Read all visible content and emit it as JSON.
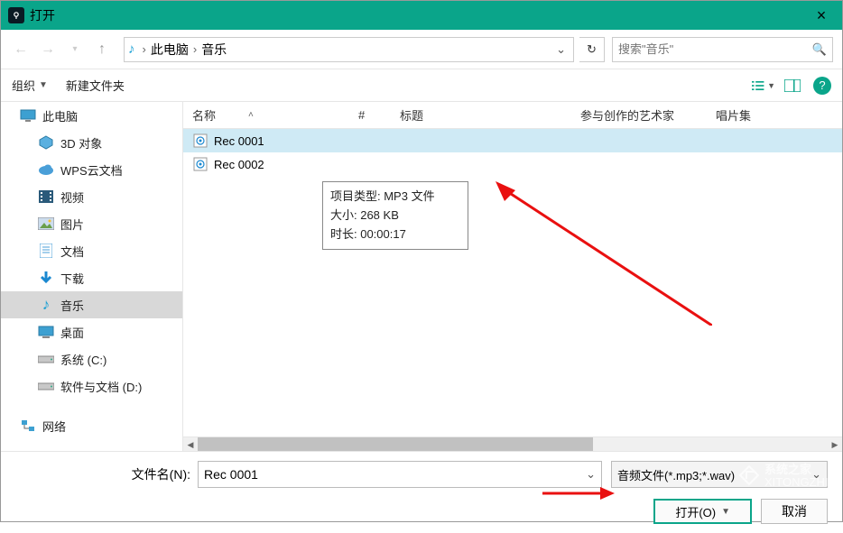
{
  "window": {
    "title": "打开"
  },
  "nav": {
    "crumb1": "此电脑",
    "crumb2": "音乐",
    "search_placeholder": "搜索\"音乐\""
  },
  "toolbar": {
    "organize": "组织",
    "newfolder": "新建文件夹"
  },
  "sidebar": [
    {
      "label": "此电脑",
      "icon": "pc",
      "child": false
    },
    {
      "label": "3D 对象",
      "icon": "3d",
      "child": true
    },
    {
      "label": "WPS云文档",
      "icon": "cloud",
      "child": true
    },
    {
      "label": "视频",
      "icon": "video",
      "child": true
    },
    {
      "label": "图片",
      "icon": "image",
      "child": true
    },
    {
      "label": "文档",
      "icon": "doc",
      "child": true
    },
    {
      "label": "下载",
      "icon": "download",
      "child": true
    },
    {
      "label": "音乐",
      "icon": "music",
      "child": true,
      "selected": true
    },
    {
      "label": "桌面",
      "icon": "desktop",
      "child": true
    },
    {
      "label": "系统 (C:)",
      "icon": "drive",
      "child": true
    },
    {
      "label": "软件与文档 (D:)",
      "icon": "drive",
      "child": true
    },
    {
      "label": "网络",
      "icon": "network",
      "child": false
    }
  ],
  "columns": {
    "name": "名称",
    "num": "#",
    "title": "标题",
    "artist": "参与创作的艺术家",
    "album": "唱片集"
  },
  "files": [
    {
      "name": "Rec 0001",
      "selected": true
    },
    {
      "name": "Rec 0002",
      "selected": false
    }
  ],
  "tooltip": {
    "line1": "项目类型: MP3 文件",
    "line2": "大小: 268 KB",
    "line3": "时长: 00:00:17"
  },
  "footer": {
    "filename_label": "文件名(N):",
    "filename_value": "Rec 0001",
    "filter": "音频文件(*.mp3;*.wav)",
    "open": "打开(O)",
    "cancel": "取消"
  },
  "watermark": {
    "brand": "系统之家",
    "url": "XITONGZHIJIA.NET"
  }
}
